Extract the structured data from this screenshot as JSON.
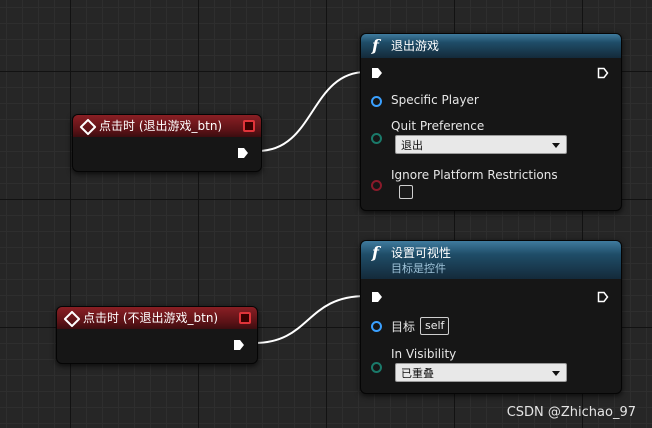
{
  "event_node_1": {
    "title": "点击时 (退出游戏_btn)"
  },
  "event_node_2": {
    "title": "点击时 (不退出游戏_btn)"
  },
  "quit_node": {
    "icon": "function-icon",
    "title": "退出游戏",
    "pins": {
      "specific_player": "Specific Player",
      "quit_preference": "Quit Preference",
      "quit_preference_value": "退出",
      "ignore_restrictions": "Ignore Platform Restrictions"
    }
  },
  "visibility_node": {
    "icon": "function-icon",
    "title": "设置可视性",
    "subtitle": "目标是控件",
    "pins": {
      "target": "目标",
      "target_value": "self",
      "in_visibility": "In Visibility",
      "in_visibility_value": "已重叠"
    }
  },
  "watermark": "CSDN @Zhichao_97",
  "colors": {
    "event_header": "#8a1f24",
    "function_header": "#3f7b9e",
    "object_pin": "#3aa0ff",
    "enum_pin": "#1a7a6a",
    "bool_pin": "#8a1a2a",
    "grid_bg": "#262626"
  }
}
